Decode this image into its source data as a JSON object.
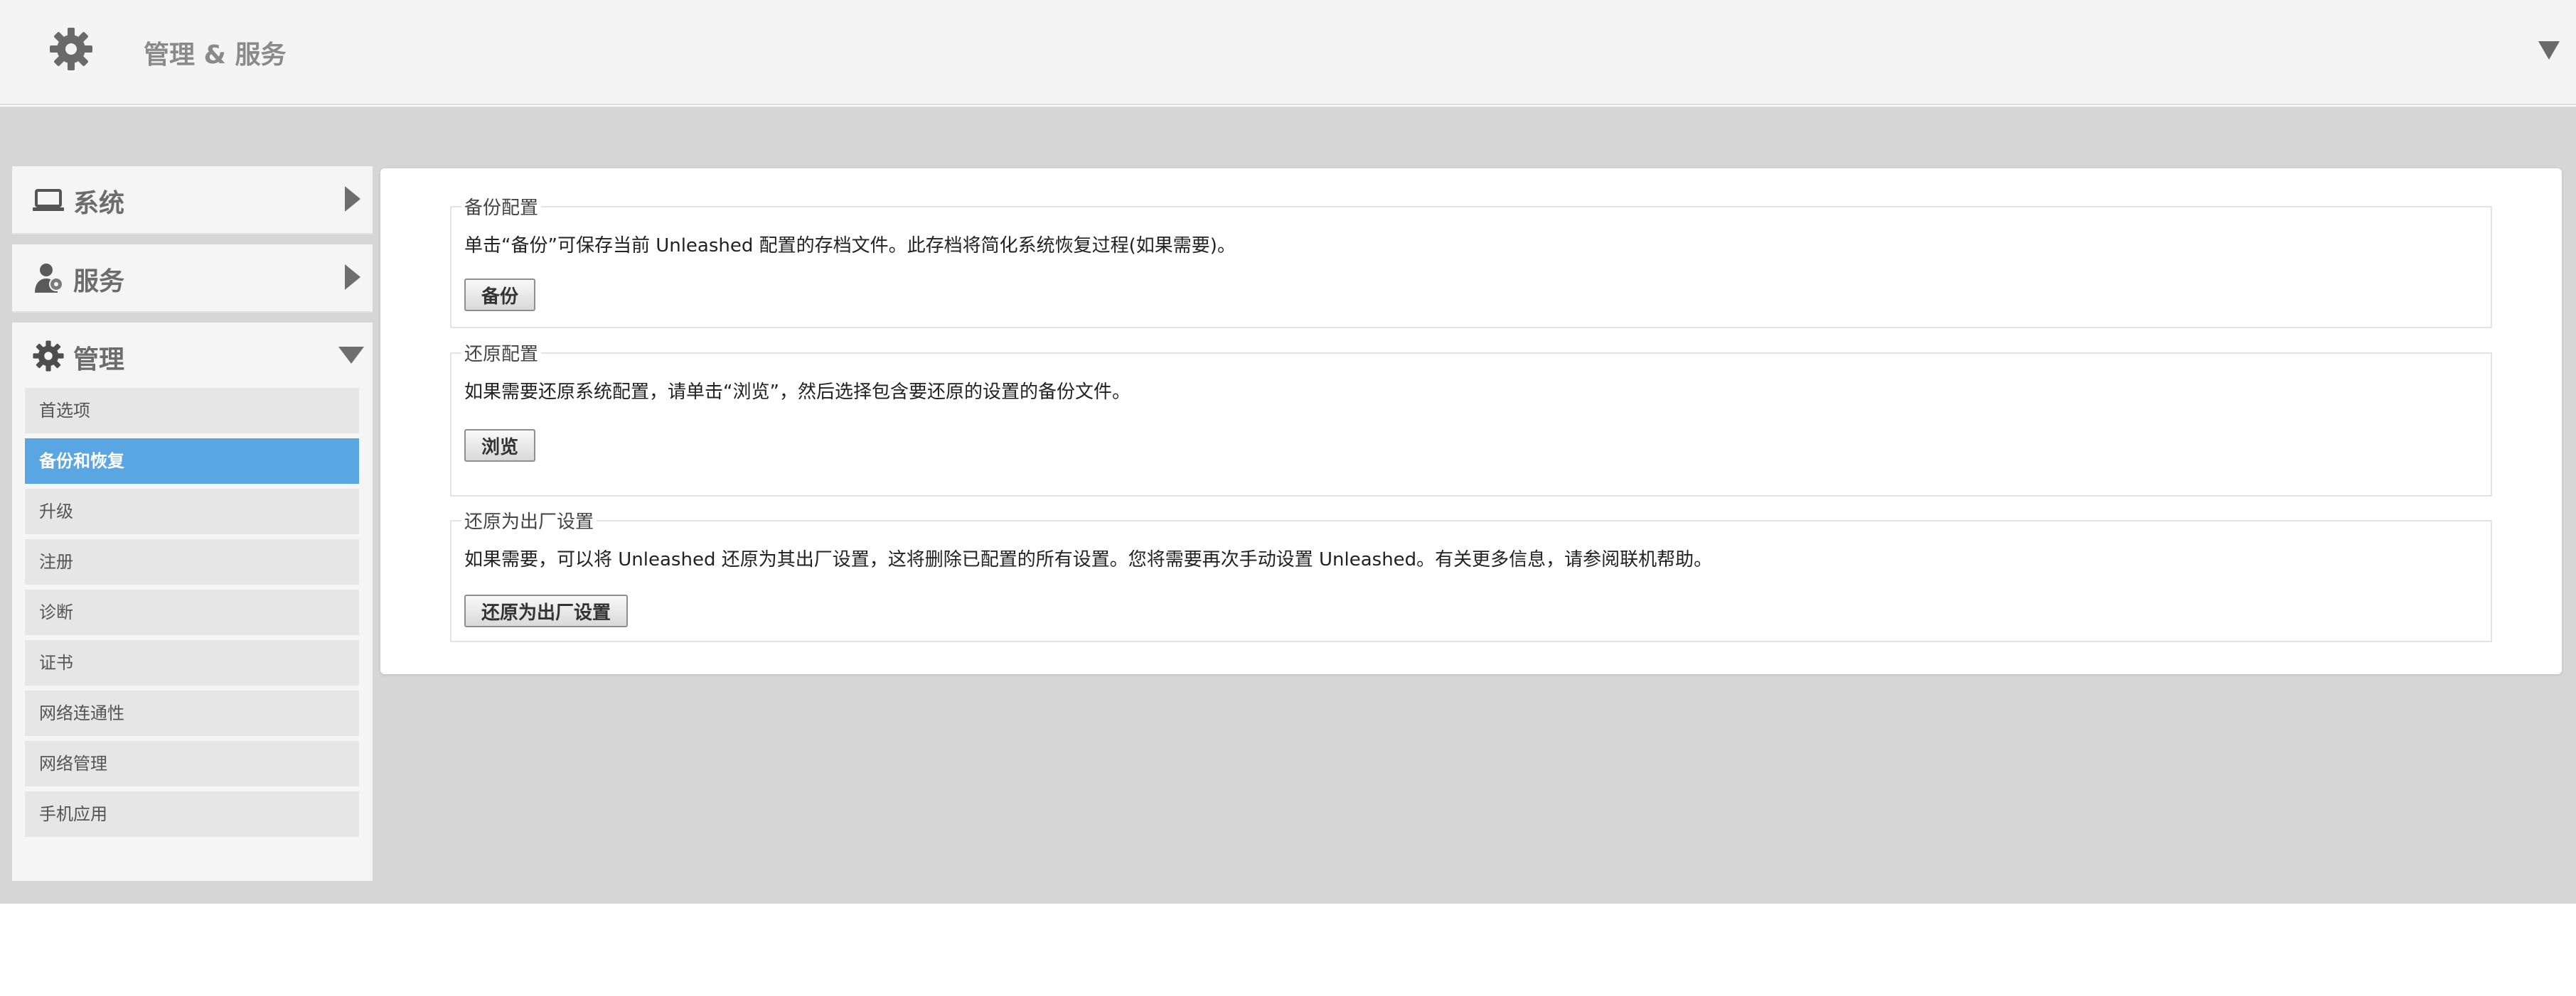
{
  "header": {
    "title": "管理 & 服务"
  },
  "sidebar": {
    "sections": [
      {
        "label": "系统",
        "icon": "laptop-icon"
      },
      {
        "label": "服务",
        "icon": "services-icon"
      },
      {
        "label": "管理",
        "icon": "gear-icon"
      }
    ],
    "items": [
      {
        "label": "首选项",
        "active": false
      },
      {
        "label": "备份和恢复",
        "active": true
      },
      {
        "label": "升级",
        "active": false
      },
      {
        "label": "注册",
        "active": false
      },
      {
        "label": "诊断",
        "active": false
      },
      {
        "label": "证书",
        "active": false
      },
      {
        "label": "网络连通性",
        "active": false
      },
      {
        "label": "网络管理",
        "active": false
      },
      {
        "label": "手机应用",
        "active": false
      }
    ]
  },
  "main": {
    "backup": {
      "legend": "备份配置",
      "description": "单击“备份”可保存当前 Unleashed 配置的存档文件。此存档将简化系统恢复过程(如果需要)。",
      "button": "备份"
    },
    "restore": {
      "legend": "还原配置",
      "description": "如果需要还原系统配置，请单击“浏览”，然后选择包含要还原的设置的备份文件。",
      "button": "浏览"
    },
    "factory": {
      "legend": "还原为出厂设置",
      "description": "如果需要，可以将 Unleashed 还原为其出厂设置，这将删除已配置的所有设置。您将需要再次手动设置 Unleashed。有关更多信息，请参阅联机帮助。",
      "button": "还原为出厂设置"
    }
  },
  "colors": {
    "accent": "#5aa6e3",
    "workspace": "#d6d6d6"
  }
}
